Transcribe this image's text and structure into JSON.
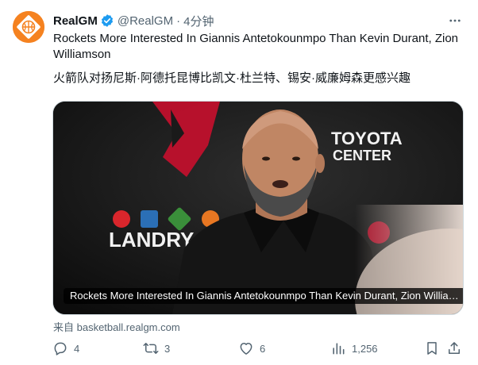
{
  "author": {
    "name": "RealGM",
    "handle": "@RealGM",
    "separator": "·",
    "time": "4分钟"
  },
  "tweet": {
    "text_en": "Rockets More Interested In Giannis Antetokounmpo Than Kevin Durant, Zion Williamson",
    "text_zh": "火箭队对扬尼斯·阿德托昆博比凯文·杜兰特、锡安·威廉姆森更感兴趣"
  },
  "card": {
    "caption": "Rockets More Interested In Giannis Antetokounmpo Than Kevin Durant, Zion Williamson",
    "image_text": {
      "toyota": "TOYOTA",
      "center": "CENTER",
      "landry": "LANDRY"
    },
    "source": "来自 basketball.realgm.com"
  },
  "actions": {
    "replies": "4",
    "reposts": "3",
    "likes": "6",
    "views": "1,256"
  },
  "colors": {
    "brand_orange": "#f58220",
    "verified_blue": "#1d9bf0",
    "secondary_text": "#536471",
    "rockets_red": "#c8102e"
  }
}
